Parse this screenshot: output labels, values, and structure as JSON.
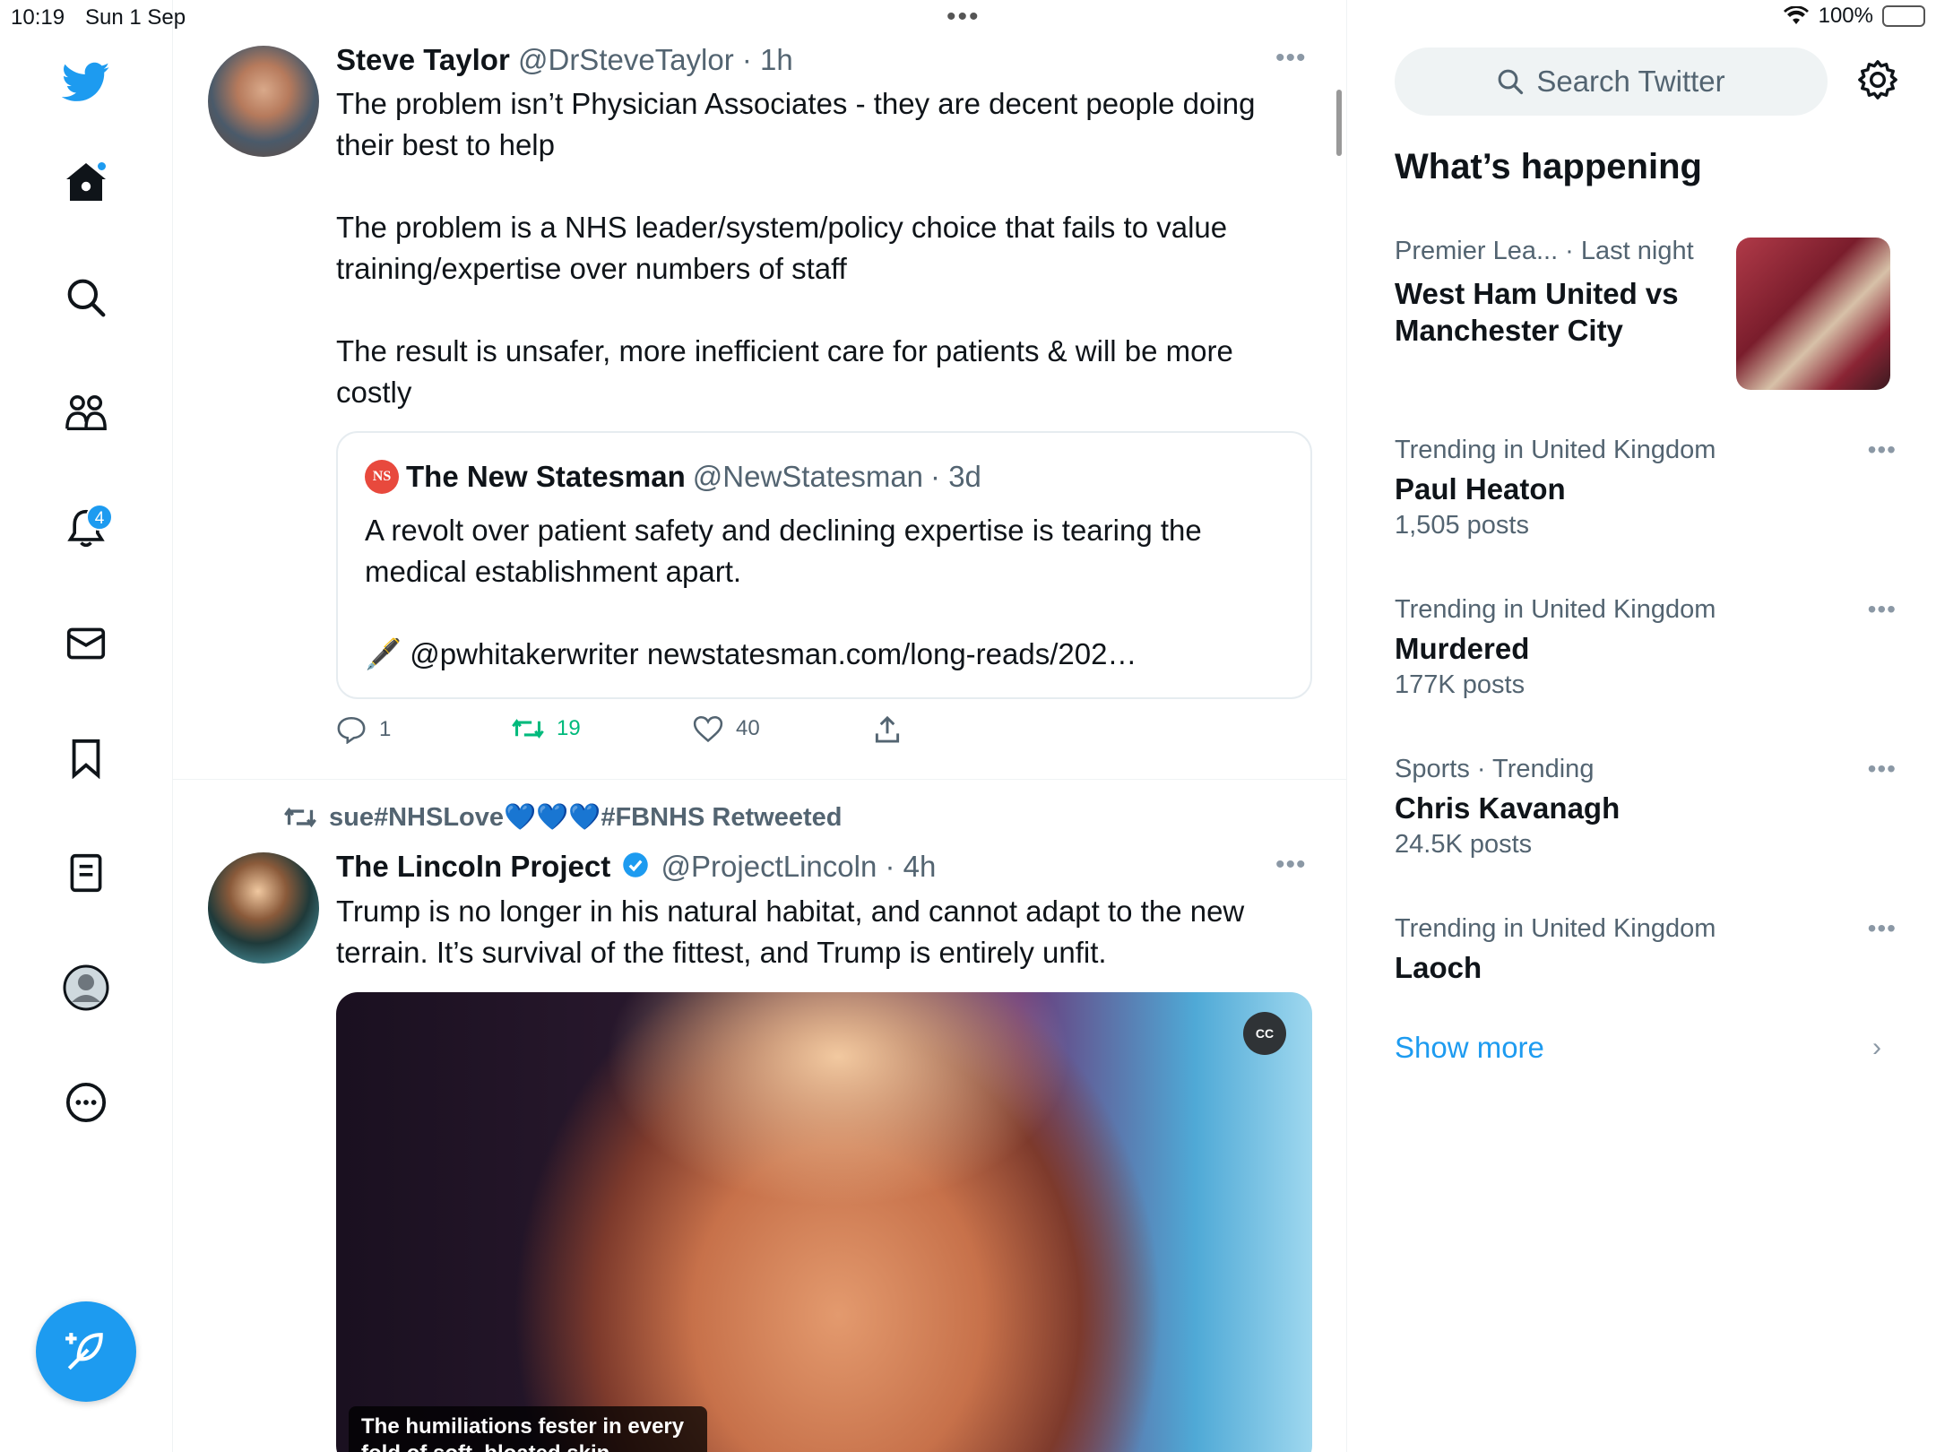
{
  "status_bar": {
    "time": "10:19",
    "date": "Sun 1 Sep",
    "battery": "100%"
  },
  "nav": {
    "notifications_badge": "4"
  },
  "tweets": [
    {
      "name": "Steve Taylor",
      "handle": "@DrSteveTaylor",
      "time": "· 1h",
      "text": "The problem isn’t Physician Associates - they are decent people doing their best to help\n\nThe problem is a NHS leader/system/policy choice that fails to value training/expertise over numbers of staff\n\nThe result is unsafer, more inefficient care for patients & will be more costly",
      "quote": {
        "name": "The New Statesman",
        "handle": "@NewStatesman",
        "time": "· 3d",
        "logo": "NS",
        "text": "A revolt over patient safety and declining expertise is tearing the medical establishment apart.\n\n🖋️ @pwhitakerwriter newstatesman.com/long-reads/202…"
      },
      "replies": "1",
      "retweets": "19",
      "likes": "40"
    },
    {
      "retweeted_by": "sue#NHSLove💙💙💙#FBNHS Retweeted",
      "name": "The Lincoln Project",
      "handle": "@ProjectLincoln",
      "time": "· 4h",
      "text": "Trump is no longer in his natural habitat, and cannot adapt to the new terrain. It’s survival of the fittest, and Trump is entirely unfit.",
      "media_caption": "The humiliations fester in every fold of soft, bloated skin",
      "cc_label": "CC"
    }
  ],
  "sidebar": {
    "search_placeholder": "Search Twitter",
    "section_title": "What’s happening",
    "trends": [
      {
        "meta": "Premier Lea... · Last night",
        "title": "West Ham United vs Manchester City",
        "count": ""
      },
      {
        "meta": "Trending in United Kingdom",
        "title": "Paul Heaton",
        "count": "1,505 posts"
      },
      {
        "meta": "Trending in United Kingdom",
        "title": "Murdered",
        "count": "177K posts"
      },
      {
        "meta": "Sports · Trending",
        "title": "Chris Kavanagh",
        "count": "24.5K posts"
      },
      {
        "meta": "Trending in United Kingdom",
        "title": "Laoch",
        "count": ""
      }
    ],
    "show_more": "Show more"
  },
  "colors": {
    "accent": "#1d9bf0",
    "retweet": "#00ba7c",
    "secondary_text": "#536471"
  }
}
